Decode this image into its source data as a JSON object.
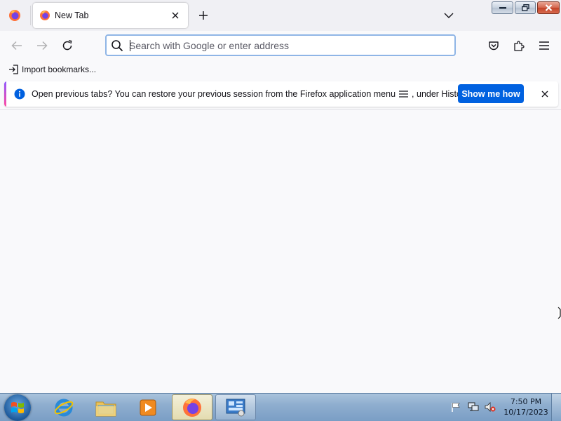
{
  "browser": {
    "tabs": [
      {
        "title": "New Tab",
        "favicon": "firefox-icon",
        "active": true
      }
    ],
    "colors": {
      "accent": "#0061e0",
      "chrome": "#f0f0f4",
      "toolbar": "#f9f9fb"
    }
  },
  "urlbar": {
    "placeholder": "Search with Google or enter address",
    "value": ""
  },
  "bookmarks": {
    "import_label": "Import bookmarks..."
  },
  "notification": {
    "message_before_icon": "Open previous tabs? You can restore your previous session from the Firefox application menu",
    "message_after_icon": ", under History.",
    "menu_icon": "hamburger-menu-icon",
    "button_label": "Show me how"
  },
  "taskbar": {
    "pinned": [
      "internet-explorer-icon",
      "file-explorer-icon",
      "media-player-icon",
      "firefox-icon",
      "control-panel-icon"
    ],
    "clock": {
      "time": "7:50 PM",
      "date": "10/17/2023"
    }
  }
}
